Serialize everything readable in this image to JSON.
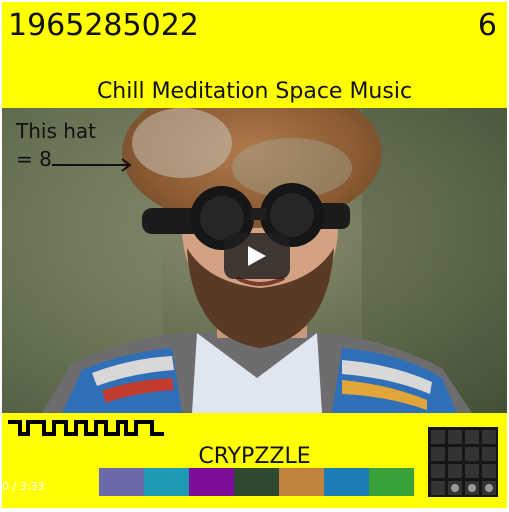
{
  "header": {
    "number_left": "1965285022",
    "number_right": "6"
  },
  "subtitle": "Chill Meditation Space Music",
  "annotation": {
    "line1": "This hat",
    "line2": "= 8"
  },
  "video": {
    "time": "0 / 3:33"
  },
  "puzzle": {
    "title": "CRYPZZLE",
    "swatch_colors": [
      "#6a6aa8",
      "#1f99b6",
      "#7c0e9a",
      "#2f4a2f",
      "#c0823c",
      "#1b7db6",
      "#3aa23a"
    ],
    "grid_rows": 4,
    "grid_cols": 4,
    "grid_dots_row": 3,
    "grid_dots_cols": [
      1,
      2,
      3
    ]
  },
  "colors": {
    "background": "#ffff00",
    "text": "#111111"
  }
}
